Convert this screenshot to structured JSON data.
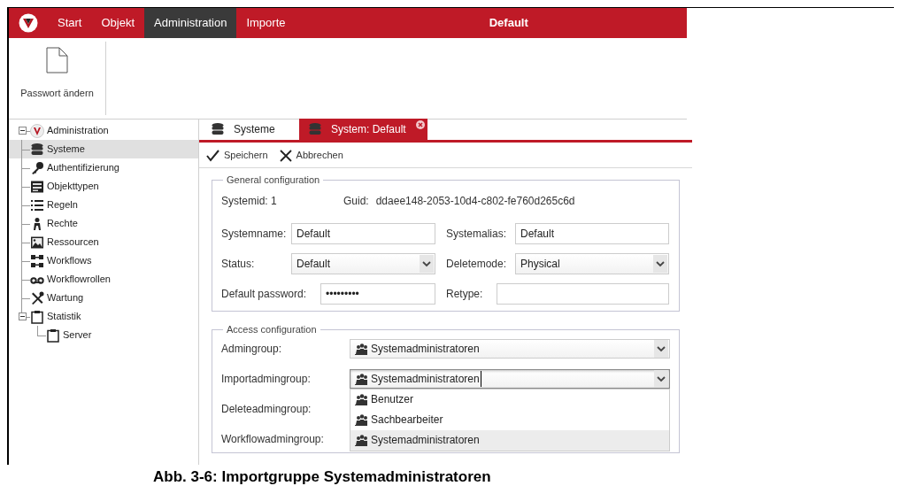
{
  "menu": {
    "tabs": [
      {
        "label": "Start",
        "selected": false
      },
      {
        "label": "Objekt",
        "selected": false
      },
      {
        "label": "Administration",
        "selected": true
      },
      {
        "label": "Importe",
        "selected": false
      }
    ],
    "title": "Default"
  },
  "ribbon": {
    "buttons": [
      {
        "label": "Passwort ändern"
      }
    ]
  },
  "tree": {
    "label": "Administration",
    "kind": "logo",
    "expanded": true,
    "selected": false,
    "children": [
      {
        "label": "Systeme",
        "kind": "database",
        "selected": true
      },
      {
        "label": "Authentifizierung",
        "kind": "key",
        "selected": false
      },
      {
        "label": "Objekttypen",
        "kind": "form",
        "selected": false
      },
      {
        "label": "Regeln",
        "kind": "list",
        "selected": false
      },
      {
        "label": "Rechte",
        "kind": "person",
        "selected": false
      },
      {
        "label": "Ressourcen",
        "kind": "image",
        "selected": false
      },
      {
        "label": "Workflows",
        "kind": "workflow",
        "selected": false
      },
      {
        "label": "Workflowrollen",
        "kind": "tape",
        "selected": false
      },
      {
        "label": "Wartung",
        "kind": "tools",
        "selected": false
      },
      {
        "label": "Statistik",
        "kind": "clipboard",
        "expanded": true,
        "selected": false,
        "children": [
          {
            "label": "Server",
            "kind": "clipboard",
            "selected": false
          }
        ]
      }
    ]
  },
  "tabs": [
    {
      "label": "Systeme",
      "selected": false,
      "closable": false
    },
    {
      "label": "System: Default",
      "selected": true,
      "closable": true
    }
  ],
  "toolbar": [
    {
      "kind": "check",
      "label": "Speichern"
    },
    {
      "kind": "cross",
      "label": "Abbrechen"
    }
  ],
  "general": {
    "legend": "General configuration",
    "systemid": "Systemid: 1",
    "guid_label": "Guid:",
    "guid": "ddaee148-2053-10d4-c802-fe760d265c6d",
    "rows": [
      [
        {
          "label": "Systemname:",
          "kind": "text",
          "value": "Default"
        },
        {
          "label": "Systemalias:",
          "kind": "text",
          "value": "Default"
        }
      ],
      [
        {
          "label": "Status:",
          "kind": "select",
          "value": "Default"
        },
        {
          "label": "Deletemode:",
          "kind": "select",
          "value": "Physical"
        }
      ],
      [
        {
          "label": "Default password:",
          "kind": "password",
          "value": "•••••••••"
        },
        {
          "label": "Retype:",
          "kind": "password"
        }
      ]
    ]
  },
  "access": {
    "legend": "Access configuration",
    "rows": [
      {
        "label": "Admingroup:",
        "value": "Systemadministratoren",
        "open": false
      },
      {
        "label": "Importadmingroup:",
        "value": "Systemadministratoren",
        "open": true
      },
      {
        "label": "Deleteadmingroup:"
      },
      {
        "label": "Workflowadmingroup:"
      }
    ],
    "options": [
      {
        "label": "Benutzer",
        "selected": false
      },
      {
        "label": "Sachbearbeiter",
        "selected": false
      },
      {
        "label": "Systemadministratoren",
        "selected": true
      }
    ]
  },
  "caption": "Abb. 3-6: Importgruppe Systemadministratoren"
}
